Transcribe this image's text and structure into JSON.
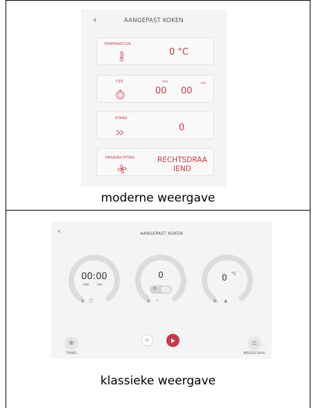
{
  "modern": {
    "title": "AANGEPAST KOKEN",
    "back_icon": "chevron-left-icon",
    "cards": [
      {
        "label": "TEMPERATUUR",
        "icon": "thermometer-icon",
        "value": "0 °C"
      },
      {
        "label": "TIJD",
        "icon": "timer-icon",
        "minutes": "00",
        "seconds": "00",
        "min_unit": "min.",
        "sec_unit": "sec."
      },
      {
        "label": "STAND",
        "icon": "speed-icon",
        "value": "0"
      },
      {
        "label": "DRAAIRICHTING",
        "icon": "rotation-fan-icon",
        "value_line1": "RECHTSDRAA",
        "value_line2": "IEND"
      }
    ]
  },
  "captions": {
    "modern": "moderne weergave",
    "classic": "klassieke weergave"
  },
  "classic": {
    "title": "AANGEPAST KOKEN",
    "back_icon": "chevron-left-icon",
    "time_dial": {
      "value": "00:00",
      "min_unit": "min.",
      "sec_unit": "sec."
    },
    "speed_dial": {
      "value": "0"
    },
    "temp_dial": {
      "value": "0",
      "unit": "°C"
    },
    "buttons": {
      "turbo_label": "TURBO",
      "scale_label": "WEEGSCHAAL"
    },
    "colors": {
      "accent": "#c8384a",
      "dial_ring": "#dddddd",
      "background": "#f4f4f4"
    }
  }
}
